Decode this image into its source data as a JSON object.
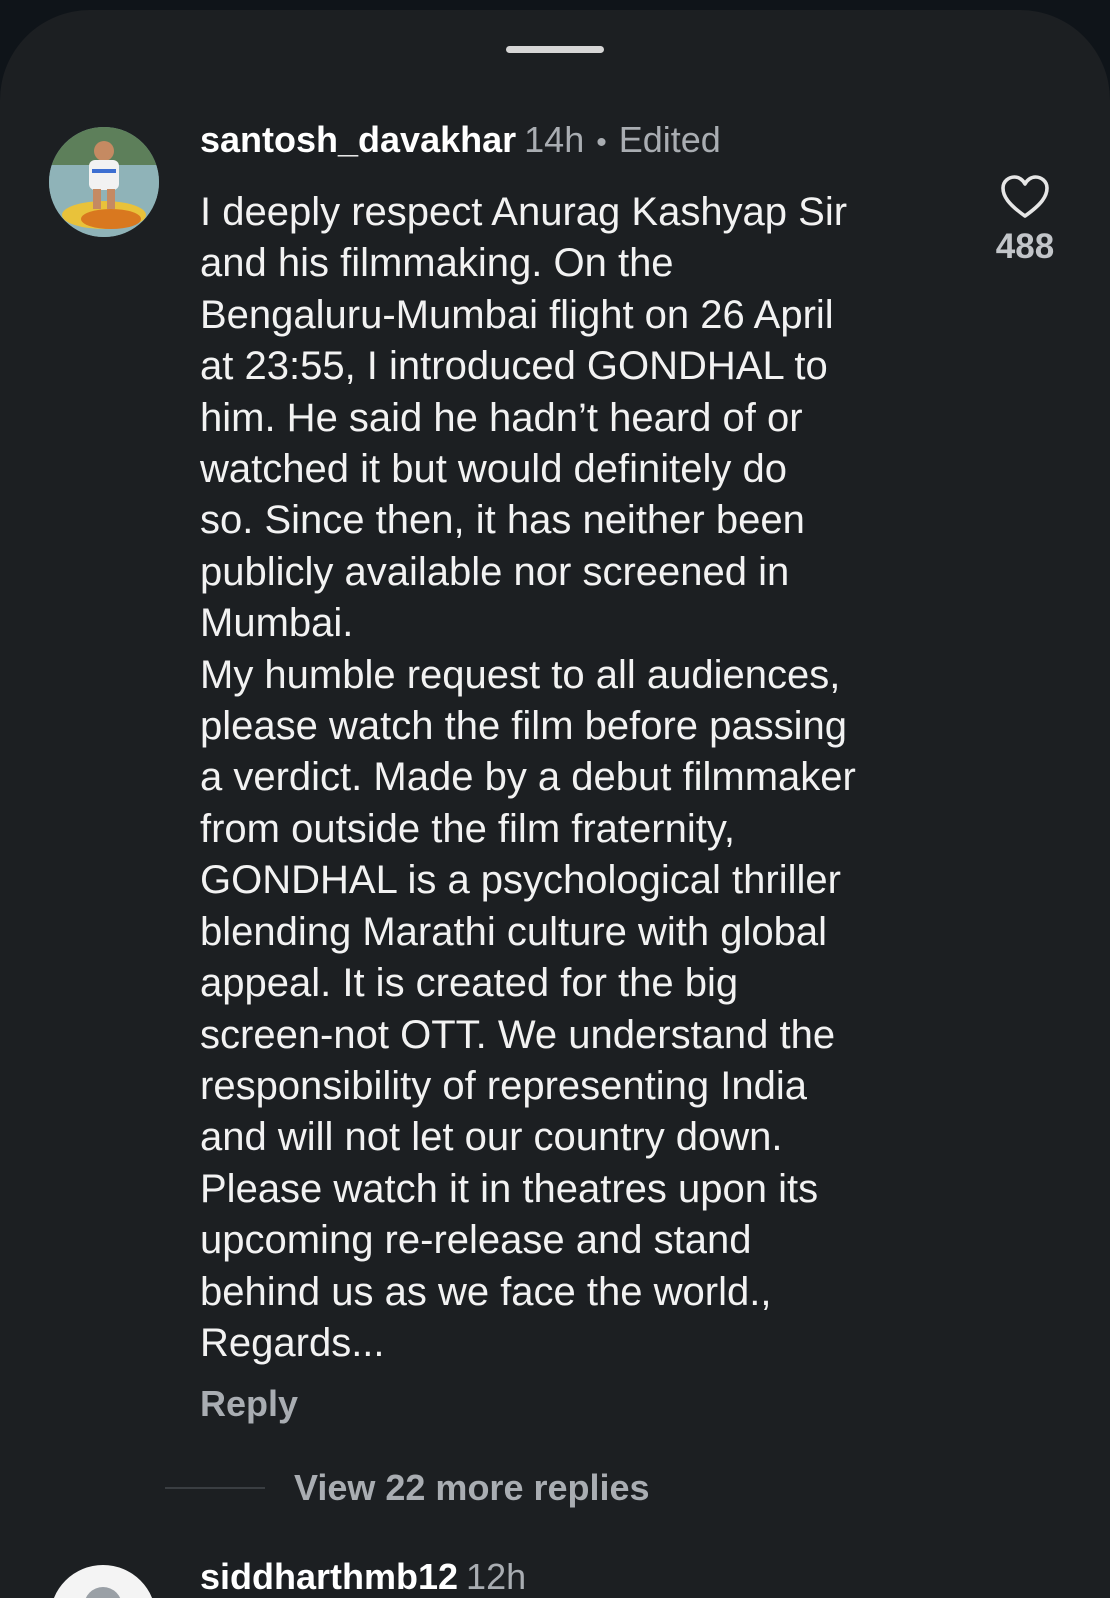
{
  "comment": {
    "username": "santosh_davakhar",
    "time": "14h",
    "separator": "•",
    "edited": "Edited",
    "body_lines": [
      "I deeply respect Anurag Kashyap Sir",
      "and his filmmaking. On the",
      "Bengaluru-Mumbai flight on 26 April",
      "at 23:55, I introduced GONDHAL to",
      "him. He said he hadn’t heard of or",
      "watched it but would definitely do",
      "so. Since then, it has neither been",
      "publicly available nor screened in",
      "Mumbai.",
      "My humble request to all audiences,",
      "please watch the film before passing",
      "a verdict. Made by a debut filmmaker",
      "from outside the film fraternity,",
      "GONDHAL is a psychological thriller",
      "blending Marathi culture with global",
      "appeal. It is created for the big",
      "screen-not OTT. We understand the",
      "responsibility of representing India",
      "and will not let our country down.",
      "Please watch it in theatres upon its",
      "upcoming re-release and stand",
      "behind us as we face the world.,",
      "Regards..."
    ],
    "reply_label": "Reply",
    "like_icon": "heart-outline-icon",
    "like_count": "488",
    "view_replies_label": "View 22 more replies"
  },
  "next_comment": {
    "username": "siddharthmb12",
    "time": "12h"
  },
  "colors": {
    "background": "#1c1f22",
    "text_primary": "#ffffff",
    "text_secondary": "#a9adb2"
  }
}
